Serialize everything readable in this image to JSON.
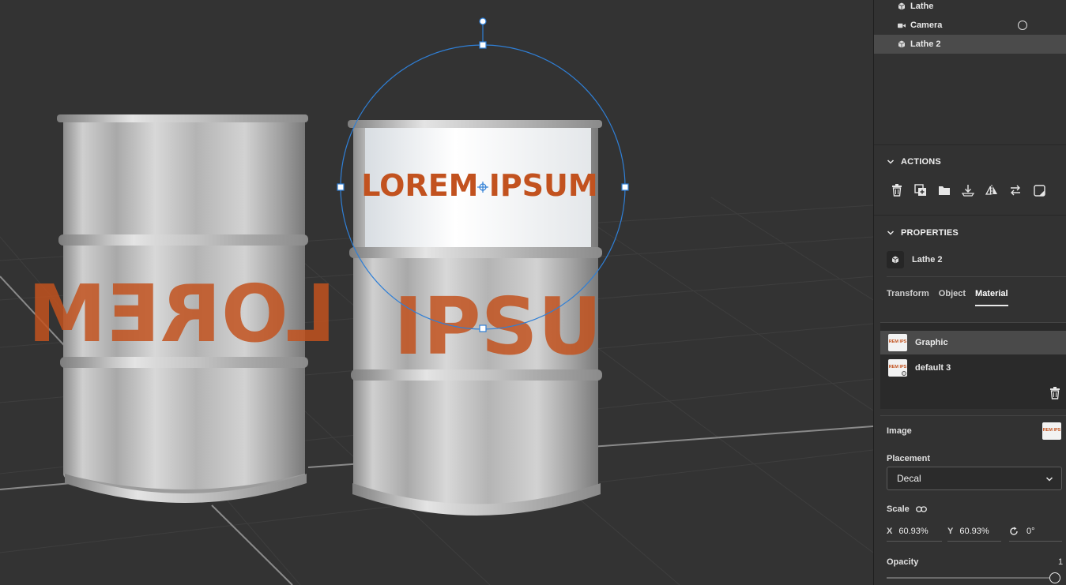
{
  "outliner": {
    "items": [
      {
        "label": "Lathe",
        "icon": "cube-icon",
        "selected": false
      },
      {
        "label": "Camera",
        "icon": "camera-icon",
        "selected": false
      },
      {
        "label": "Lathe 2",
        "icon": "cube-icon",
        "selected": true
      }
    ]
  },
  "actions": {
    "title": "ACTIONS",
    "buttons": [
      "delete-icon",
      "duplicate-icon",
      "group-icon",
      "drop-to-ground-icon",
      "mirror-icon",
      "swap-icon",
      "convert-icon"
    ]
  },
  "properties": {
    "title": "PROPERTIES",
    "object_name": "Lathe 2",
    "tabs": [
      "Transform",
      "Object",
      "Material"
    ],
    "active_tab": "Material",
    "materials": [
      {
        "name": "Graphic",
        "thumb_text": "REM IPS",
        "selected": true
      },
      {
        "name": "default 3",
        "thumb_text": "REM IPS",
        "selected": false
      }
    ],
    "image_label": "Image",
    "image_thumb_text": "REM IPS",
    "placement_label": "Placement",
    "placement_value": "Decal",
    "scale_label": "Scale",
    "scale_x_axis": "X",
    "scale_x": "60.93%",
    "scale_y_axis": "Y",
    "scale_y": "60.93%",
    "rotation": "0°",
    "opacity_label": "Opacity",
    "opacity_value": "1"
  },
  "viewport": {
    "decal_text": "LOREM IPSUM",
    "left_barrel_text": "LOREM",
    "right_barrel_text": "IPSU",
    "text_color": "#c2521f",
    "gizmo_color": "#2f7fd6"
  }
}
